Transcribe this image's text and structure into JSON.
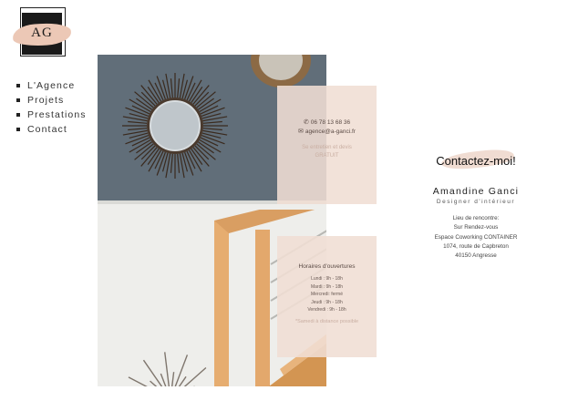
{
  "logo": {
    "letters": "AG"
  },
  "nav": {
    "items": [
      {
        "label": "L'Agence"
      },
      {
        "label": "Projets"
      },
      {
        "label": "Prestations"
      },
      {
        "label": "Contact"
      }
    ]
  },
  "card_contact": {
    "phone": "06 78 13 68 36",
    "email": "agence@a-ganci.fr",
    "quote_line1": "Se entretien et devis",
    "quote_line2": "GRATUIT",
    "icons": {
      "phone": "phone-icon",
      "email": "email-icon"
    }
  },
  "card_hours": {
    "title": "Horaires d'ouvertures",
    "rows": [
      "Lundi : 9h - 18h",
      "Mardi : 9h - 18h",
      "Mercredi: fermé",
      "Jeudi : 9h - 18h",
      "Vendredi : 9h - 18h"
    ],
    "note": "*Samedi à distance possible"
  },
  "contact": {
    "heading": "Contactez-moi!",
    "name": "Amandine Ganci",
    "role": "Designer d'intérieur",
    "address": [
      "Lieu de rencontre:",
      "Sur Rendez-vous",
      "Espace Coworking CONTAINER",
      "1074, route de Capbreton",
      "40150 Angresse"
    ]
  },
  "colors": {
    "accent": "#f0ded4",
    "wall": "#616e79",
    "wood": "#e3a86c"
  }
}
